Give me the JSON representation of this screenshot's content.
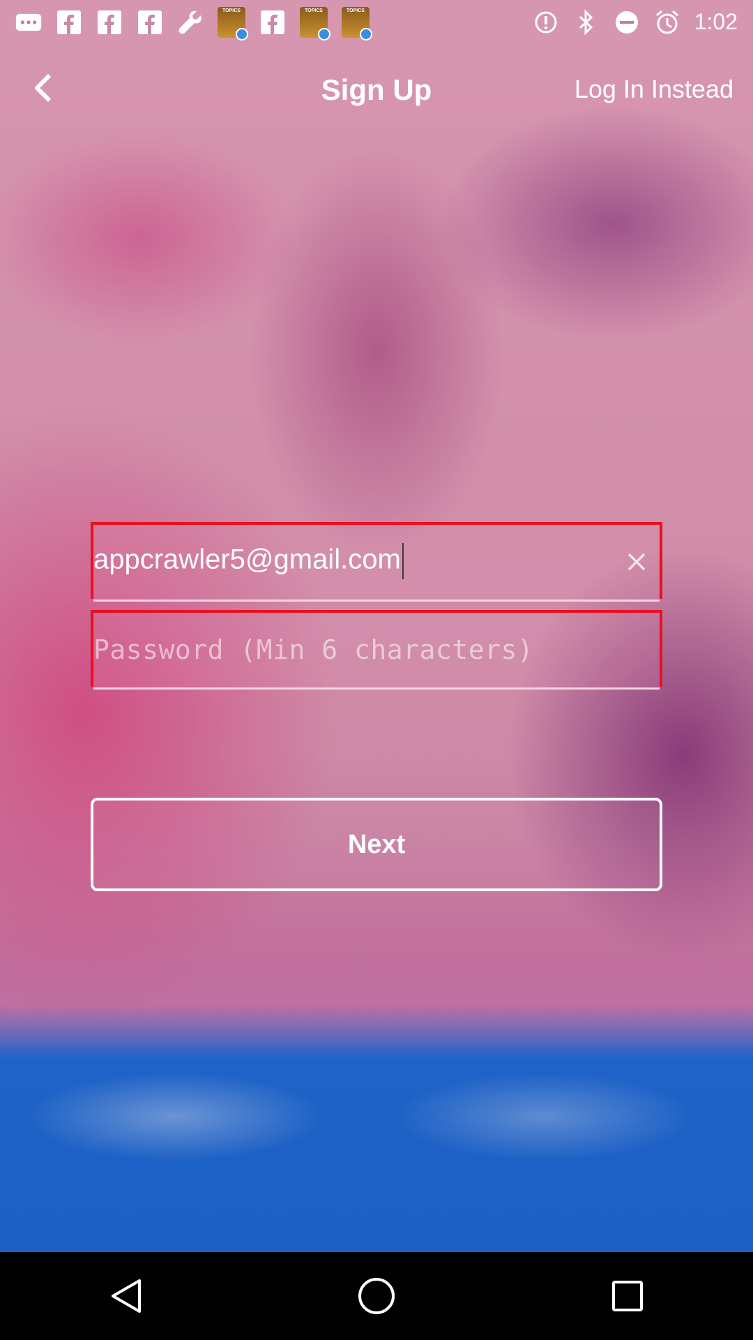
{
  "status_bar": {
    "time": "1:02",
    "left_icons": [
      "more-icon",
      "facebook-icon",
      "facebook-icon",
      "facebook-icon",
      "wrench-icon",
      "topics-app-icon",
      "facebook-icon",
      "topics-app-icon",
      "topics-app-icon"
    ],
    "app_thumb_label": "TOPICS",
    "right_icons": [
      "alert-icon",
      "bluetooth-icon",
      "do-not-disturb-icon",
      "alarm-icon"
    ]
  },
  "header": {
    "title": "Sign Up",
    "login_link": "Log In Instead",
    "back_icon": "chevron-left-icon"
  },
  "form": {
    "email_value": "appcrawler5@gmail.com",
    "password_placeholder": "Password (Min 6 characters)",
    "next_label": "Next"
  },
  "colors": {
    "field_border": "#e8101d",
    "accent_blue": "#1f63c8"
  },
  "nav_bar": {
    "icons": [
      "back-triangle-icon",
      "home-circle-icon",
      "recents-square-icon"
    ]
  }
}
